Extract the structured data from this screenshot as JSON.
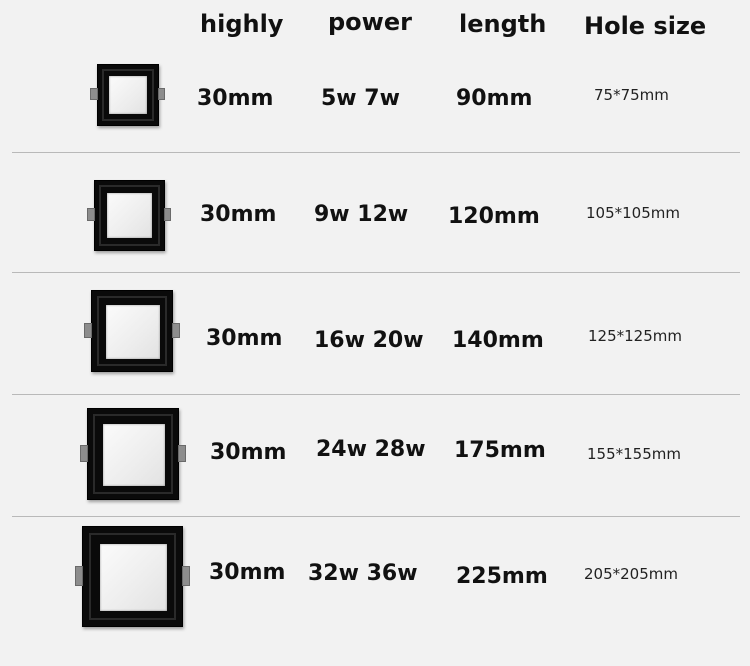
{
  "headers": {
    "highly": "highly",
    "power": "power",
    "length": "length",
    "hole_size": "Hole size"
  },
  "rows": [
    {
      "highly": "30mm",
      "power": "5w 7w",
      "length": "90mm",
      "hole_size": "75*75mm"
    },
    {
      "highly": "30mm",
      "power": "9w 12w",
      "length": "120mm",
      "hole_size": "105*105mm"
    },
    {
      "highly": "30mm",
      "power": "16w 20w",
      "length": "140mm",
      "hole_size": "125*125mm"
    },
    {
      "highly": "30mm",
      "power": "24w 28w",
      "length": "175mm",
      "hole_size": "155*155mm"
    },
    {
      "highly": "30mm",
      "power": "32w 36w",
      "length": "225mm",
      "hole_size": "205*205mm"
    }
  ],
  "colors": {
    "background": "#f2f2f2",
    "fixture_frame": "#0a0a0a",
    "fixture_panel": "#f5f5f5",
    "divider": "#b9b9b9"
  }
}
